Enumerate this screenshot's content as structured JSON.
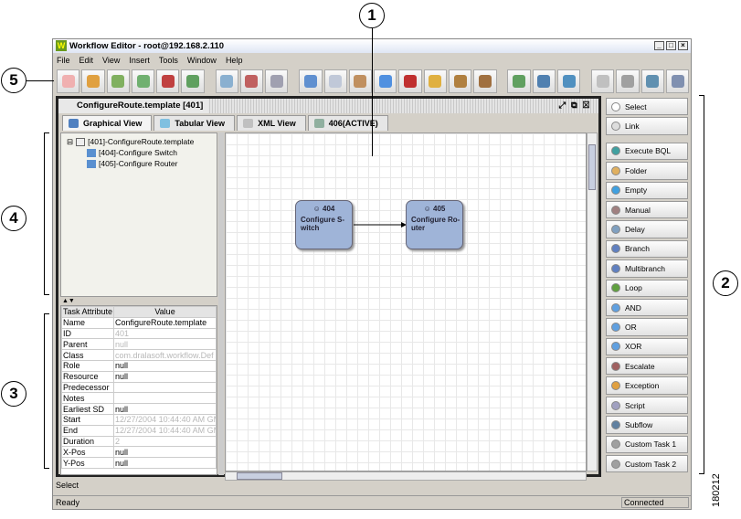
{
  "window": {
    "title": "Workflow Editor - root@192.168.2.110",
    "logo": "W"
  },
  "menu": [
    "File",
    "Edit",
    "View",
    "Insert",
    "Tools",
    "Window",
    "Help"
  ],
  "toolbar": [
    {
      "icon": "new-icon",
      "color": "#f0b0b0"
    },
    {
      "icon": "open-icon",
      "color": "#e0a040"
    },
    {
      "icon": "download-icon",
      "color": "#80b060"
    },
    {
      "icon": "upload-icon",
      "color": "#70b070"
    },
    {
      "icon": "delete-file-icon",
      "color": "#c04040"
    },
    {
      "icon": "run-icon",
      "color": "#60a060"
    },
    {
      "sep": true
    },
    {
      "icon": "gear-icon",
      "color": "#8ab0d0"
    },
    {
      "icon": "gear-stop-icon",
      "color": "#c06060"
    },
    {
      "icon": "gear-settings-icon",
      "color": "#a0a0b0"
    },
    {
      "sep": true
    },
    {
      "icon": "cut-icon",
      "color": "#6090d0"
    },
    {
      "icon": "copy-icon",
      "color": "#c0c8d8"
    },
    {
      "icon": "paste-icon",
      "color": "#c09060"
    },
    {
      "icon": "layout-icon",
      "color": "#5090e0"
    },
    {
      "icon": "delete-icon",
      "color": "#c03030"
    },
    {
      "icon": "folder-up-icon",
      "color": "#e0b040"
    },
    {
      "icon": "package-icon",
      "color": "#b08040"
    },
    {
      "icon": "package-down-icon",
      "color": "#a07040"
    },
    {
      "sep": true
    },
    {
      "icon": "zoom-in-icon",
      "color": "#60a060"
    },
    {
      "icon": "zoom-out-icon",
      "color": "#5080b0"
    },
    {
      "icon": "zoom-fit-icon",
      "color": "#5090c0"
    },
    {
      "sep": true
    },
    {
      "icon": "grid-icon",
      "color": "#c0c0c0"
    },
    {
      "icon": "print-icon",
      "color": "#a0a0a0"
    },
    {
      "icon": "user-gear-icon",
      "color": "#6090b0"
    },
    {
      "icon": "settings-icon",
      "color": "#8090b0"
    }
  ],
  "document": {
    "title": "ConfigureRoute.template [401]"
  },
  "tabs": [
    {
      "label": "Graphical View",
      "color": "#5080c0"
    },
    {
      "label": "Tabular View",
      "color": "#80c0e0"
    },
    {
      "label": "XML View",
      "color": "#c0c0c0"
    },
    {
      "label": "406(ACTIVE)",
      "color": "#90b0a0"
    }
  ],
  "tree": {
    "root": "[401]-ConfigureRoute.template",
    "children": [
      "[404]-Configure Switch",
      "[405]-Configure Router"
    ]
  },
  "attributes": {
    "headers": [
      "Task Attribute",
      "Value"
    ],
    "rows": [
      [
        "Name",
        "ConfigureRoute.template",
        false
      ],
      [
        "ID",
        "401",
        true
      ],
      [
        "Parent",
        "null",
        true
      ],
      [
        "Class",
        "com.dralasoft.workflow.Def",
        true
      ],
      [
        "Role",
        "null",
        false
      ],
      [
        "Resource",
        "null",
        false
      ],
      [
        "Predecessor",
        "",
        false
      ],
      [
        "Notes",
        "",
        false
      ],
      [
        "Earliest SD",
        "null",
        false
      ],
      [
        "Start",
        "12/27/2004 10:44:40 AM GM",
        true
      ],
      [
        "End",
        "12/27/2004 10:44:40 AM GM",
        true
      ],
      [
        "Duration",
        "2",
        true
      ],
      [
        "X-Pos",
        "null",
        false
      ],
      [
        "Y-Pos",
        "null",
        false
      ]
    ]
  },
  "nodes": [
    {
      "id": "404",
      "label": "Configure S-\nwitch"
    },
    {
      "id": "405",
      "label": "Configure Ro-\nuter"
    }
  ],
  "palette": [
    {
      "label": "Select",
      "color": "#fff"
    },
    {
      "label": "Link",
      "color": "#ddd"
    },
    {
      "label": "Execute BQL",
      "color": "#40a0a0",
      "sep": true
    },
    {
      "label": "Folder",
      "color": "#e0b060"
    },
    {
      "label": "Empty",
      "color": "#40a0e0"
    },
    {
      "label": "Manual",
      "color": "#a08080"
    },
    {
      "label": "Delay",
      "color": "#80a0c0"
    },
    {
      "label": "Branch",
      "color": "#6080c0"
    },
    {
      "label": "Multibranch",
      "color": "#6080c0"
    },
    {
      "label": "Loop",
      "color": "#60a040"
    },
    {
      "label": "AND",
      "color": "#60a0e0"
    },
    {
      "label": "OR",
      "color": "#60a0e0"
    },
    {
      "label": "XOR",
      "color": "#60a0e0"
    },
    {
      "label": "Escalate",
      "color": "#a06060"
    },
    {
      "label": "Exception",
      "color": "#e0a040"
    },
    {
      "label": "Script",
      "color": "#a0a0c0"
    },
    {
      "label": "Subflow",
      "color": "#6080a0"
    },
    {
      "label": "Custom Task 1",
      "color": "#a0a0a0"
    },
    {
      "label": "Custom Task 2",
      "color": "#a0a0a0"
    }
  ],
  "status": {
    "hint": "Select",
    "state": "Ready",
    "connection": "Connected"
  },
  "callouts": [
    "1",
    "2",
    "3",
    "4",
    "5"
  ],
  "figure_id": "180212"
}
